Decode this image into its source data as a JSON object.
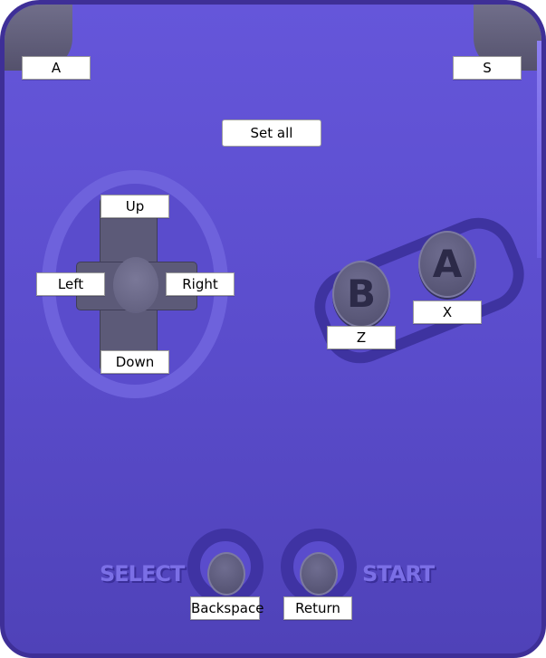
{
  "shoulders": {
    "left_key": "A",
    "right_key": "S"
  },
  "set_all_button": "Set all",
  "dpad": {
    "up": "Up",
    "left": "Left",
    "right": "Right",
    "down": "Down"
  },
  "face_buttons": {
    "a_glyph": "A",
    "b_glyph": "B",
    "a_key": "X",
    "b_key": "Z"
  },
  "system_buttons": {
    "select_text": "SELECT",
    "start_text": "START",
    "select_key": "Backspace",
    "start_key": "Return"
  },
  "colors": {
    "body": "#5a4ccb",
    "border": "#3e2f97",
    "button": "#5c5a78",
    "label_text": "#7b6fe6"
  }
}
